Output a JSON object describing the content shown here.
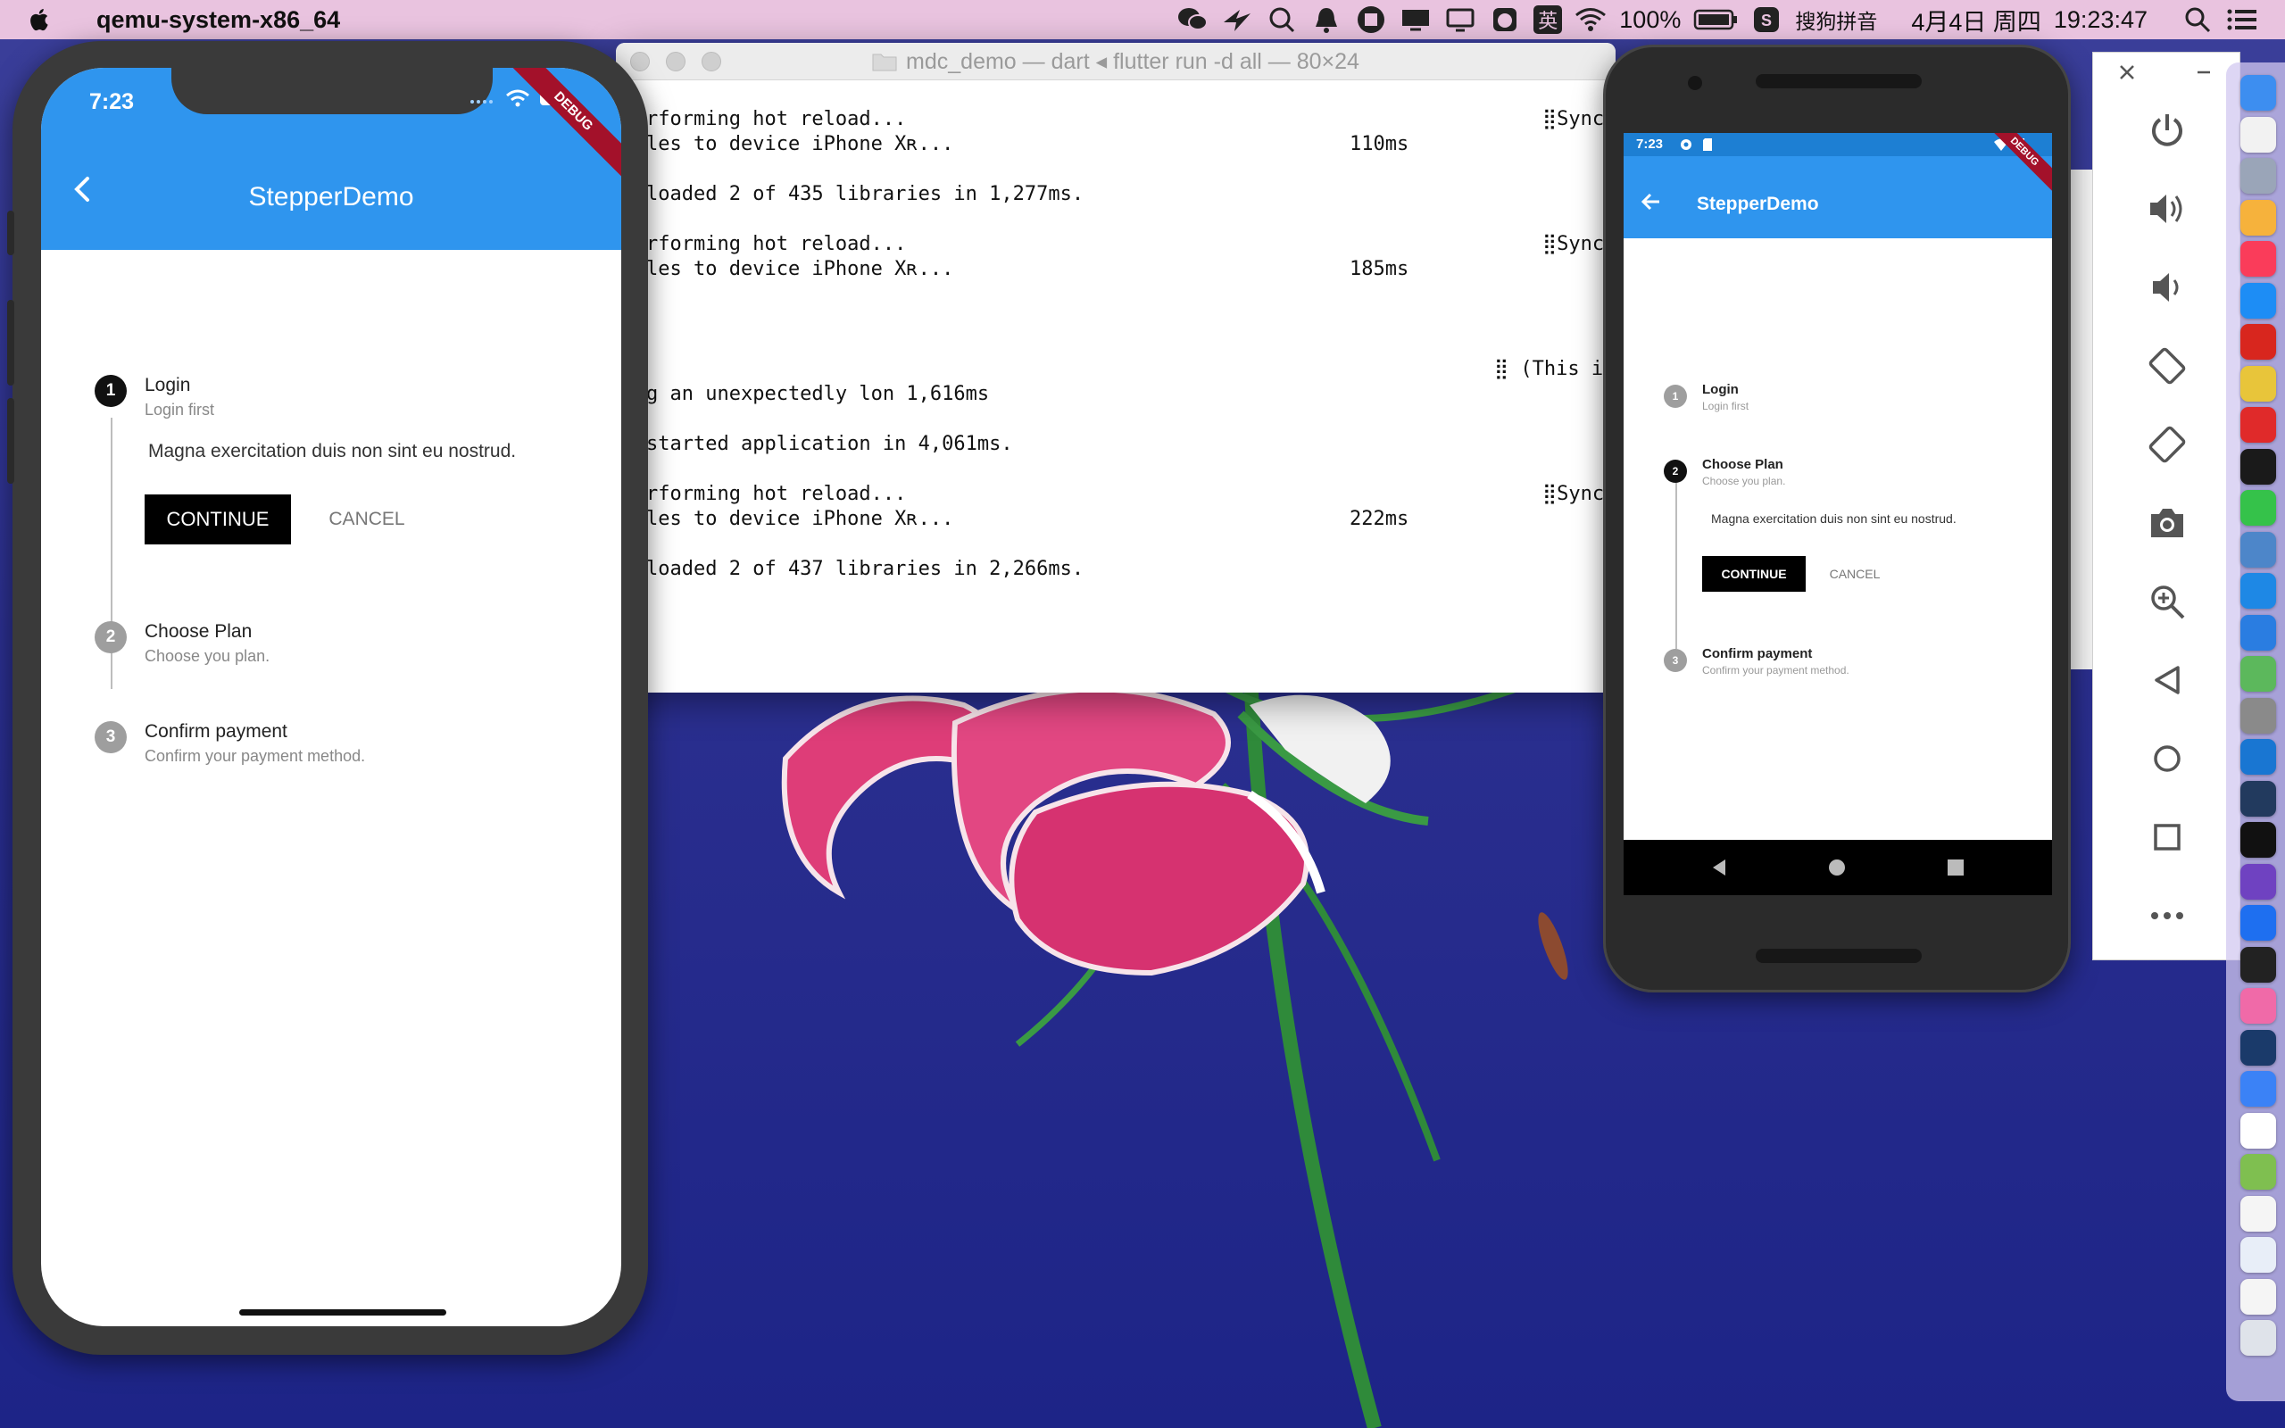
{
  "menubar": {
    "app_name": "qemu-system-x86_64",
    "ime_label": "英",
    "battery": "100%",
    "input_method": "搜狗拼音",
    "date": "4月4日 周四",
    "time": "19:23:47"
  },
  "terminal": {
    "title": "mdc_demo — dart ◂ flutter run -d all — 80×24",
    "lines": [
      "rforming hot reload...",
      "les to device iPhone Xʀ...",
      "",
      "loaded 2 of 435 libraries in 1,277ms.",
      "",
      "rforming hot reload...",
      "les to device iPhone Xʀ...",
      "",
      "",
      "",
      "",
      "g an unexpectedly lon 1,616ms",
      "",
      "started application in 4,061ms.",
      "",
      "rforming hot reload...",
      "les to device iPhone Xʀ...",
      "",
      "loaded 2 of 437 libraries in 2,266ms."
    ],
    "right_notes": [
      {
        "text": "⣿Syncing",
        "row": 0
      },
      {
        "text": "110ms",
        "row": 1
      },
      {
        "text": "⣿Syncing",
        "row": 5
      },
      {
        "text": "185ms",
        "row": 6
      },
      {
        "text": "⣿ (This is t",
        "row": 10
      },
      {
        "text": "⣿Syncing",
        "row": 15
      },
      {
        "text": "222ms",
        "row": 16
      }
    ]
  },
  "iphone": {
    "time": "7:23",
    "debug_label": "DEBUG",
    "app_title": "StepperDemo",
    "steps": [
      {
        "number": "1",
        "title": "Login",
        "subtitle": "Login first",
        "active": true
      },
      {
        "number": "2",
        "title": "Choose Plan",
        "subtitle": "Choose you plan.",
        "active": false
      },
      {
        "number": "3",
        "title": "Confirm payment",
        "subtitle": "Confirm your payment method.",
        "active": false
      }
    ],
    "content_text": "Magna exercitation duis non sint eu nostrud.",
    "continue_label": "CONTINUE",
    "cancel_label": "CANCEL"
  },
  "android": {
    "time": "7:23",
    "debug_label": "DEBUG",
    "app_title": "StepperDemo",
    "steps": [
      {
        "number": "1",
        "title": "Login",
        "subtitle": "Login first",
        "active": false
      },
      {
        "number": "2",
        "title": "Choose Plan",
        "subtitle": "Choose you plan.",
        "active": true
      },
      {
        "number": "3",
        "title": "Confirm payment",
        "subtitle": "Confirm your payment method.",
        "active": false
      }
    ],
    "content_text": "Magna exercitation duis non sint eu nostrud.",
    "continue_label": "CONTINUE",
    "cancel_label": "CANCEL"
  },
  "emulator_panel": {
    "controls": [
      "close-icon",
      "minimize-icon",
      "power-icon",
      "volume-up-icon",
      "volume-down-icon",
      "rotate-left-icon",
      "rotate-right-icon",
      "camera-icon",
      "zoom-icon",
      "back-icon",
      "home-icon",
      "overview-icon",
      "more-icon"
    ]
  },
  "dock": {
    "icons": [
      {
        "name": "finder-icon",
        "color": "#3d8ef0"
      },
      {
        "name": "notes-icon",
        "color": "#f2f2f2"
      },
      {
        "name": "launchpad-icon",
        "color": "#9aa5b8"
      },
      {
        "name": "photos-icon",
        "color": "#f6b23c"
      },
      {
        "name": "music-icon",
        "color": "#fa3c5a"
      },
      {
        "name": "appstore-icon",
        "color": "#1d8df5"
      },
      {
        "name": "app-red-icon",
        "color": "#d8261e"
      },
      {
        "name": "chrome-icon",
        "color": "#e8c53a"
      },
      {
        "name": "youdao-icon",
        "color": "#e02a2a"
      },
      {
        "name": "qq-icon",
        "color": "#1a1a1a"
      },
      {
        "name": "wechat-icon",
        "color": "#35c24a"
      },
      {
        "name": "preview-icon",
        "color": "#4d86c9"
      },
      {
        "name": "safari-icon",
        "color": "#1e88e5"
      },
      {
        "name": "mplus-icon",
        "color": "#2a7de1"
      },
      {
        "name": "android-studio-icon",
        "color": "#5cb85c"
      },
      {
        "name": "system-prefs-icon",
        "color": "#8a8a8a"
      },
      {
        "name": "xcode-icon",
        "color": "#1976d2"
      },
      {
        "name": "vscode-icon",
        "color": "#223a5e"
      },
      {
        "name": "webstorm-icon",
        "color": "#111111"
      },
      {
        "name": "github-icon",
        "color": "#6f42c1"
      },
      {
        "name": "maps-icon",
        "color": "#1e6ff0"
      },
      {
        "name": "terminal-icon",
        "color": "#222222"
      },
      {
        "name": "display-icon",
        "color": "#f06aa8"
      },
      {
        "name": "quicktime-icon",
        "color": "#1a3a6a"
      },
      {
        "name": "simulator-icon",
        "color": "#3b82f6"
      },
      {
        "name": "mail-icon",
        "color": "#ffffff"
      },
      {
        "name": "green-app-icon",
        "color": "#7fbf50"
      },
      {
        "name": "doc-icon",
        "color": "#f5f5f5"
      },
      {
        "name": "files-icon",
        "color": "#e8eef8"
      },
      {
        "name": "doc2-icon",
        "color": "#f5f5f5"
      },
      {
        "name": "trash-icon",
        "color": "#dfe3ea"
      }
    ]
  }
}
